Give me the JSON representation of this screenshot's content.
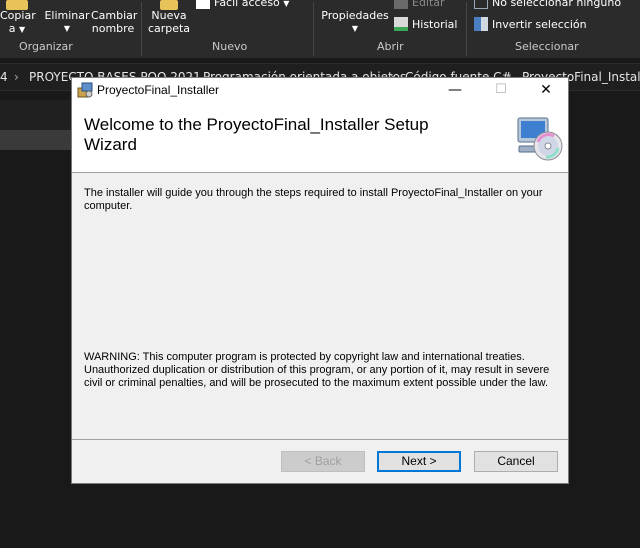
{
  "ribbon": {
    "copy_label": "Copiar",
    "copy_sub": "a",
    "delete_label": "Eliminar",
    "rename_label_1": "Cambiar",
    "rename_label_2": "nombre",
    "new_folder_1": "Nueva",
    "new_folder_2": "carpeta",
    "easy_access": "Fácil acceso",
    "properties": "Propiedades",
    "edit": "Editar",
    "history": "Historial",
    "select_none": "No seleccionar ninguno",
    "invert_selection": "Invertir selección",
    "groups": {
      "organize": "Organizar",
      "new": "Nuevo",
      "open": "Abrir",
      "select": "Seleccionar"
    }
  },
  "address": {
    "crumbs": [
      "4",
      "PROYECTO BASES POO 2021",
      "Programación orientada a objetos",
      "Código fuente C#",
      "ProyectoFinal_Installer"
    ]
  },
  "dialog": {
    "window_title": "ProyectoFinal_Installer",
    "header_title": "Welcome to the ProyectoFinal_Installer Setup Wizard",
    "intro_text": "The installer will guide you through the steps required to install ProyectoFinal_Installer on your computer.",
    "warning_text": "WARNING: This computer program is protected by copyright law and international treaties. Unauthorized duplication or distribution of this program, or any portion of it, may result in severe civil or criminal penalties, and will be prosecuted to the maximum extent possible under the law.",
    "back_label": "< Back",
    "next_label": "Next >",
    "cancel_label": "Cancel",
    "minimize_glyph": "—",
    "maximize_glyph": "☐",
    "close_glyph": "✕"
  },
  "colors": {
    "accent": "#0078d7",
    "dialog_bg": "#f0f0f0",
    "explorer_bg": "#191919"
  }
}
